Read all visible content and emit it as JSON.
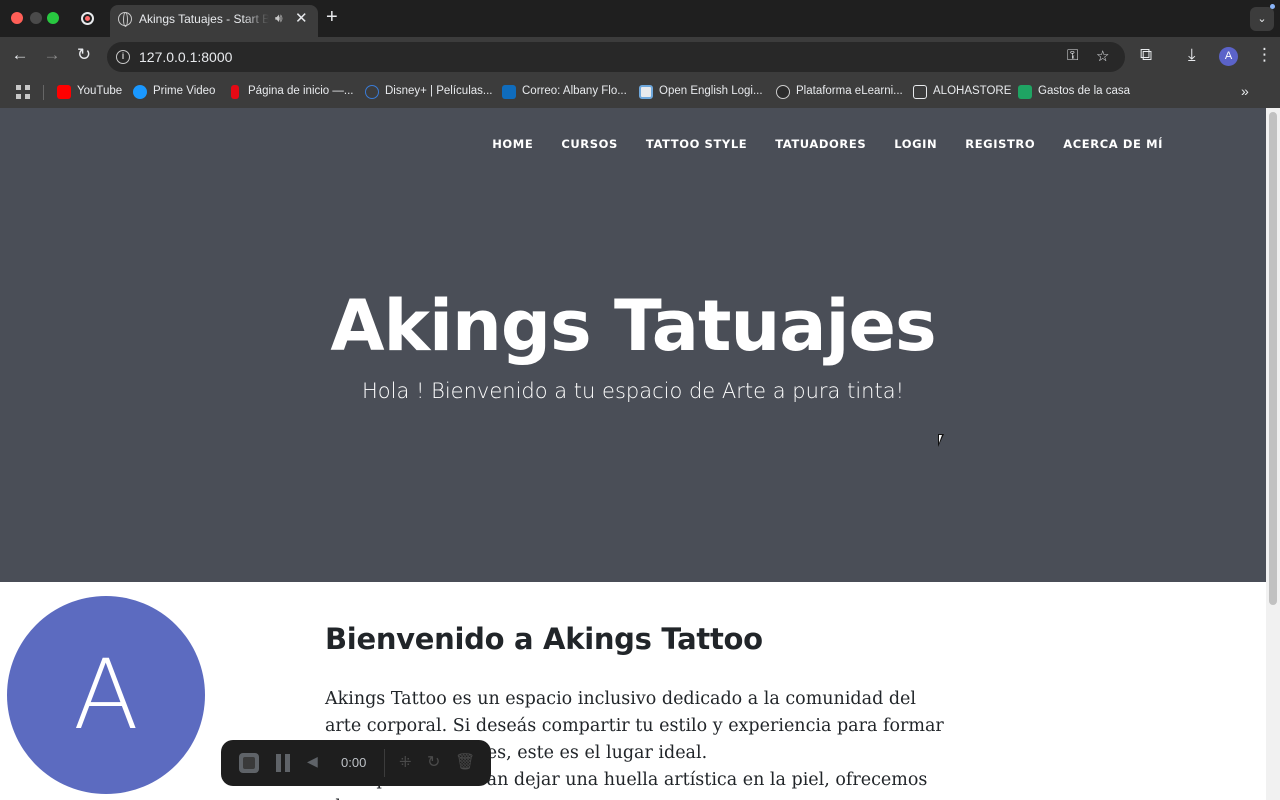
{
  "browser": {
    "tab": {
      "title": "Akings Tatuajes - Start Bo",
      "audio_icon": "speaker-icon",
      "close": "✕"
    },
    "new_tab": "+",
    "url": "127.0.0.1:8000",
    "bookmarks": [
      {
        "label": "YouTube",
        "color": "#ff0000"
      },
      {
        "label": "Prime Video",
        "color": "#1a98ff"
      },
      {
        "label": "Página de inicio —...",
        "color": "#e50914"
      },
      {
        "label": "Disney+ | Películas...",
        "color": "#113ccf"
      },
      {
        "label": "Correo: Albany Flo...",
        "color": "#0f6cbd"
      },
      {
        "label": "Open English Logi...",
        "color": "#e8eaed"
      },
      {
        "label": "Plataforma eLearni...",
        "color": "#cccccc"
      },
      {
        "label": "ALOHASTORE",
        "color": "#e8eaed"
      },
      {
        "label": "Gastos de la casa",
        "color": "#1fa463"
      }
    ],
    "avatar_letter": "A"
  },
  "site": {
    "nav": [
      "HOME",
      "CURSOS",
      "TATTOO STYLE",
      "TATUADORES",
      "LOGIN",
      "REGISTRO",
      "ACERCA DE MÍ"
    ],
    "hero_title": "Akings Tatuajes",
    "hero_subtitle": "Hola ! Bienvenido a tu espacio de Arte a pura tinta!",
    "avatar_letter": "A",
    "about_title": "Bienvenido a Akings Tattoo",
    "about_paragraph_1": "Akings Tattoo es un espacio inclusivo dedicado a la comunidad del arte corporal. Si deseás compartir tu estilo y experiencia para formar a futuros tatuadores, este es el lugar ideal.",
    "about_paragraph_2": "Para quienes buscan dejar una huella artística en la piel, ofrecemos el"
  },
  "recorder": {
    "time": "0:00"
  },
  "colors": {
    "hero_bg": "#4a4e57",
    "avatar_bg": "#5c6bc0"
  }
}
